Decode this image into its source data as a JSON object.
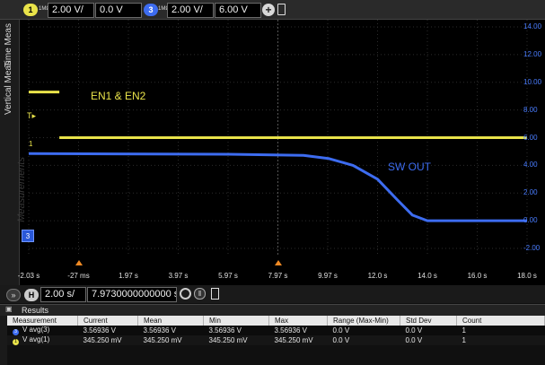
{
  "channels": {
    "ch1": {
      "badge": "1",
      "impedance": "1MΩ",
      "scale": "2.00 V/",
      "offset": "0.0 V",
      "color": "#e9e34a"
    },
    "ch3": {
      "badge": "3",
      "impedance": "1MΩ",
      "scale": "2.00 V/",
      "offset": "6.00 V",
      "color": "#3d6cf0"
    }
  },
  "side_tabs": {
    "time_meas": "Time Meas",
    "vertical_meas": "Vertical Meas",
    "watermark": "Measurements"
  },
  "trace_labels": {
    "ch1": "EN1 & EN2",
    "ch3": "SW OUT"
  },
  "ch1_marker": "1",
  "ch3_marker": "3",
  "y_axis_ticks": [
    "14.00",
    "12.00",
    "10.00",
    "8.00",
    "6.00",
    "4.00",
    "2.00",
    "0.00",
    "-2.00"
  ],
  "x_axis_ticks": [
    "-2.03 s",
    "-27 ms",
    "1.97 s",
    "3.97 s",
    "5.97 s",
    "7.97 s",
    "9.97 s",
    "12.0 s",
    "14.0 s",
    "16.0 s",
    "18.0 s"
  ],
  "timebase": {
    "badge": "H",
    "scale": "2.00 s/",
    "position": "7.9730000000000 s"
  },
  "results": {
    "title": "Results",
    "columns": [
      "Measurement",
      "Current",
      "Mean",
      "Min",
      "Max",
      "Range (Max-Min)",
      "Std Dev",
      "Count"
    ],
    "rows": [
      {
        "channel": "3",
        "cells": [
          "V avg(3)",
          "3.56936 V",
          "3.56936 V",
          "3.56936 V",
          "3.56936 V",
          "0.0 V",
          "0.0 V",
          "1"
        ]
      },
      {
        "channel": "1",
        "cells": [
          "V avg(1)",
          "345.250 mV",
          "345.250 mV",
          "345.250 mV",
          "345.250 mV",
          "0.0 V",
          "0.0 V",
          "1"
        ]
      }
    ]
  },
  "chart_data": {
    "type": "line",
    "x_unit": "s",
    "y_unit": "V",
    "xlim": [
      -2.03,
      18.0
    ],
    "ylim": [
      -2.0,
      14.0
    ],
    "y_axis_ticks": [
      14,
      12,
      10,
      8,
      6,
      4,
      2,
      0,
      -2
    ],
    "x_axis_ticks": [
      -2.03,
      -0.027,
      1.97,
      3.97,
      5.97,
      7.97,
      9.97,
      12.0,
      14.0,
      16.0,
      18.0
    ],
    "grid": true,
    "series": [
      {
        "name": "EN1 & EN2",
        "color": "#e9e34a",
        "points": [
          [
            -2.03,
            9.3
          ],
          [
            -0.8,
            9.3
          ]
        ]
      },
      {
        "name": "EN1 & EN2",
        "color": "#e9e34a",
        "points": [
          [
            -0.8,
            6.0
          ],
          [
            18.0,
            6.0
          ]
        ]
      },
      {
        "name": "SW OUT",
        "color": "#3d6cf0",
        "points": [
          [
            -2.03,
            4.85
          ],
          [
            6.0,
            4.8
          ],
          [
            9.0,
            4.72
          ],
          [
            10.0,
            4.5
          ],
          [
            11.0,
            4.0
          ],
          [
            12.0,
            3.0
          ],
          [
            12.8,
            1.5
          ],
          [
            13.4,
            0.4
          ],
          [
            14.0,
            0.0
          ],
          [
            18.0,
            0.0
          ]
        ]
      }
    ]
  }
}
